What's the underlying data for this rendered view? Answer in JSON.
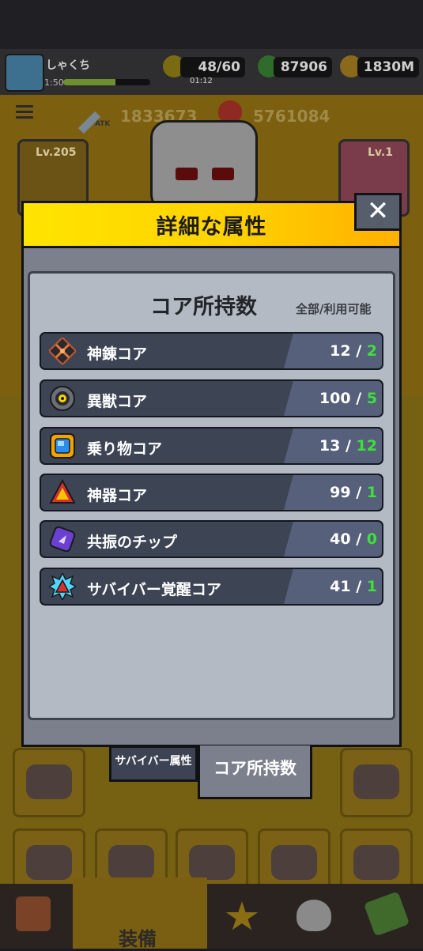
{
  "player": {
    "name": "しゃくち",
    "level_label": "1:50",
    "xp_fraction": 0.6
  },
  "resources": {
    "energy": "48/60",
    "energy_timer": "01:12",
    "gems": "87906",
    "coins": "1830M"
  },
  "stats": {
    "atk_label": "ATK",
    "atk_value": "1833673",
    "hp_label": "HP",
    "hp_value": "5761084"
  },
  "background_cards": {
    "left_level": "Lv.205",
    "right_level": "Lv.1",
    "slot_level": "Lv.1"
  },
  "dialog": {
    "title": "詳細な属性",
    "close_label": "✕",
    "section_title": "コア所持数",
    "section_sub": "全部/利用可能",
    "rows": [
      {
        "label": "神錬コア",
        "total": "12",
        "available": "2",
        "icon": "divine-core-icon"
      },
      {
        "label": "異獣コア",
        "total": "100",
        "available": "5",
        "icon": "beast-core-icon"
      },
      {
        "label": "乗り物コア",
        "total": "13",
        "available": "12",
        "icon": "vehicle-core-icon"
      },
      {
        "label": "神器コア",
        "total": "99",
        "available": "1",
        "icon": "artifact-core-icon"
      },
      {
        "label": "共振のチップ",
        "total": "40",
        "available": "0",
        "icon": "resonance-chip-icon"
      },
      {
        "label": "サバイバー覚醒コア",
        "total": "41",
        "available": "1",
        "icon": "awakening-core-icon"
      }
    ],
    "tabs": {
      "inactive": "サバイバー属性",
      "active": "コア所持数"
    }
  },
  "bottom_nav": {
    "equip_label": "装備"
  },
  "colors": {
    "header_yellow": "#ffd200",
    "available_green": "#3ee03a",
    "row_bg": "#3d4454"
  }
}
